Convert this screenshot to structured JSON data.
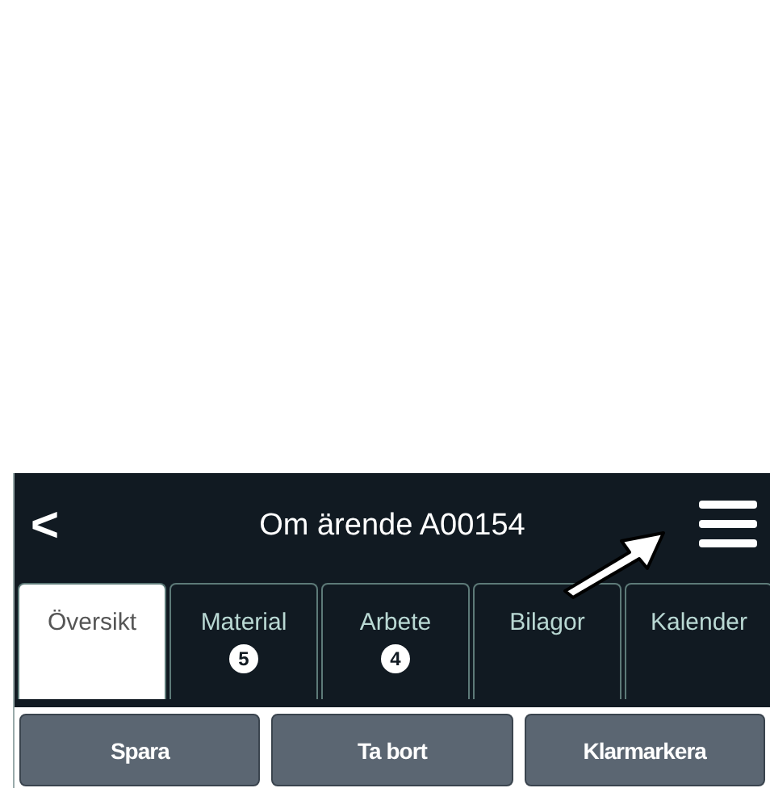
{
  "header": {
    "back": "<",
    "title": "Om ärende A00154"
  },
  "tabs": [
    {
      "label": "Översikt",
      "selected": true
    },
    {
      "label": "Material",
      "selected": false,
      "badge": "5"
    },
    {
      "label": "Arbete",
      "selected": false,
      "badge": "4"
    },
    {
      "label": "Bilagor",
      "selected": false
    },
    {
      "label": "Kalender",
      "selected": false
    }
  ],
  "buttons": [
    "Spara",
    "Ta bort",
    "Klarmarkera"
  ]
}
